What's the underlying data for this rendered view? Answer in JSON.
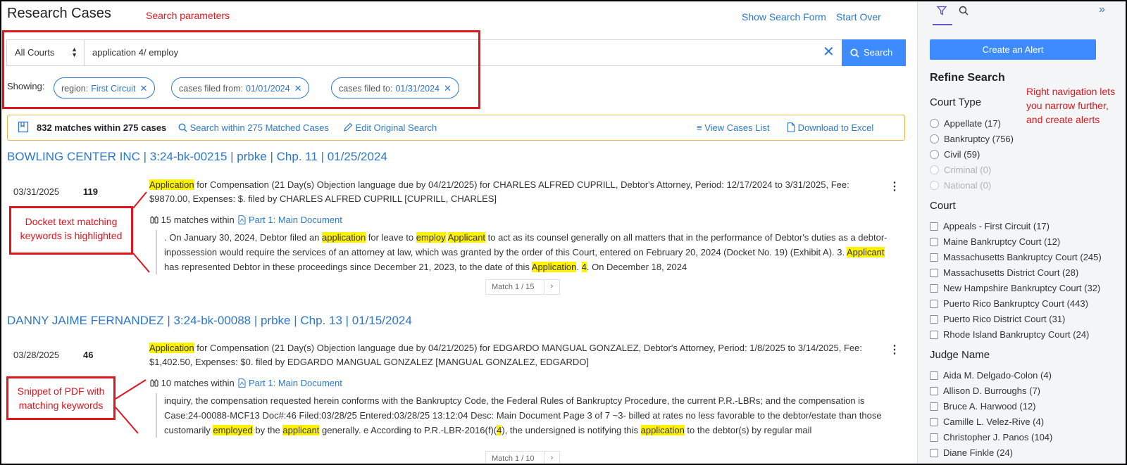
{
  "header": {
    "title": "Research Cases",
    "show_search_form": "Show Search Form",
    "start_over": "Start Over"
  },
  "search": {
    "court_selected": "All Courts",
    "query": "application 4/ employ",
    "button_label": "Search",
    "showing_label": "Showing:",
    "filters": [
      {
        "label": "region:",
        "value": "First Circuit"
      },
      {
        "label": "cases filed from:",
        "value": "01/01/2024"
      },
      {
        "label": "cases filed to:",
        "value": "01/31/2024"
      }
    ]
  },
  "summary": {
    "matches": "832 matches within 275 cases",
    "search_within": "Search within 275 Matched Cases",
    "edit_search": "Edit Original Search",
    "view_list": "View Cases List",
    "download": "Download to Excel"
  },
  "results": [
    {
      "title": "BOWLING CENTER INC | 3:24-bk-00215 | prbke | Chp. 11 | 01/25/2024",
      "entry_date": "03/31/2025",
      "entry_num": "119",
      "text_hl": "Application",
      "text_rest": " for Compensation (21 Day(s) Objection language due by 04/21/2025) for CHARLES ALFRED CUPRILL, Debtor's Attorney, Period: 12/17/2024 to 3/31/2025, Fee: $9870.00, Expenses: $. filed by CHARLES ALFRED CUPRILL [CUPRILL, CHARLES]",
      "matches_count": "15 matches within",
      "doc_link": "Part 1: Main Document",
      "snippet": {
        "s1": ". On January 30, 2024, Debtor filed an ",
        "h1": "application",
        "s2": " for leave to ",
        "h2": "employ",
        "s3": " ",
        "h3": "Applicant",
        "s4": " to act as its counsel generally on all matters that in the performance of Debtor's duties as a debtor-inpossession would require the services of an attorney at law, which was granted by the order of this Court, entered on February 20, 2024 (Docket No. 19) (Exhibit A). 3. ",
        "h4": "Applicant",
        "s5": " has represented Debtor in these proceedings since December 21, 2023, to the date of this ",
        "h5": "Application",
        "s6": ". ",
        "h6": "4",
        "s7": ". On December 18, 2024"
      },
      "pager": "Match 1 / 15"
    },
    {
      "title": "DANNY JAIME FERNANDEZ | 3:24-bk-00088 | prbke | Chp. 13 | 01/15/2024",
      "entry_date": "03/28/2025",
      "entry_num": "46",
      "text_hl": "Application",
      "text_rest": " for Compensation (21 Day(s) Objection language due by 04/21/2025) for EDGARDO MANGUAL GONZALEZ, Debtor's Attorney, Period: 1/8/2025 to 3/14/2025, Fee: $1,402.50, Expenses: $0. filed by EDGARDO MANGUAL GONZALEZ [MANGUAL GONZALEZ, EDGARDO]",
      "matches_count": "10 matches within",
      "doc_link": "Part 1: Main Document",
      "snippet": {
        "s1": "inquiry, the compensation requested herein conforms with the Bankruptcy Code, the Federal Rules of Bankruptcy Procedure, the current P.R.-LBRs; and the compensation is Case:24-00088-MCF13 Doc#:46 Filed:03/28/25 Entered:03/28/25 13:12:04 Desc: Main Document Page 3 of 7 ~3- billed at rates no less favorable to the debtor/estate than those customarily ",
        "h1": "employed",
        "s2": " by the ",
        "h2": "applicant",
        "s3": " generally. e According to P.R.-LBR-2016(f)(",
        "h3": "4",
        "s4": "), the undersigned is notifying this ",
        "h4": "application",
        "s5": " to the debtor(s) by regular mail"
      },
      "pager": "Match 1 / 10"
    }
  ],
  "annotations": {
    "search_params": "Search parameters",
    "docket_text": "Docket text matching keywords is highlighted",
    "snippet_pdf": "Snippet of PDF with matching keywords",
    "right_nav": "Right navigation lets you narrow further, and create alerts"
  },
  "sidebar": {
    "create_alert": "Create an Alert",
    "refine_title": "Refine Search",
    "court_type": {
      "title": "Court Type",
      "options": [
        {
          "label": "Appellate (17)",
          "disabled": false
        },
        {
          "label": "Bankruptcy (756)",
          "disabled": false
        },
        {
          "label": "Civil (59)",
          "disabled": false
        },
        {
          "label": "Criminal (0)",
          "disabled": true
        },
        {
          "label": "National (0)",
          "disabled": true
        }
      ]
    },
    "court": {
      "title": "Court",
      "options": [
        "Appeals - First Circuit (17)",
        "Maine Bankruptcy Court (12)",
        "Massachusetts Bankruptcy Court (245)",
        "Massachusetts District Court (28)",
        "New Hampshire Bankruptcy Court (32)",
        "Puerto Rico Bankruptcy Court (443)",
        "Puerto Rico District Court (31)",
        "Rhode Island Bankruptcy Court (24)"
      ]
    },
    "judge": {
      "title": "Judge Name",
      "options": [
        "Aida M. Delgado-Colon (4)",
        "Allison D. Burroughs (7)",
        "Bruce A. Harwood (12)",
        "Camille L. Velez-Rive (4)",
        "Christopher J. Panos (104)",
        "Diane Finkle (24)"
      ]
    }
  },
  "colors": {
    "link": "#2f76c9",
    "primary_button": "#3d8bfd",
    "highlight": "#fff200",
    "annotation_red": "#e0161e",
    "summary_border": "#f0b34a"
  }
}
